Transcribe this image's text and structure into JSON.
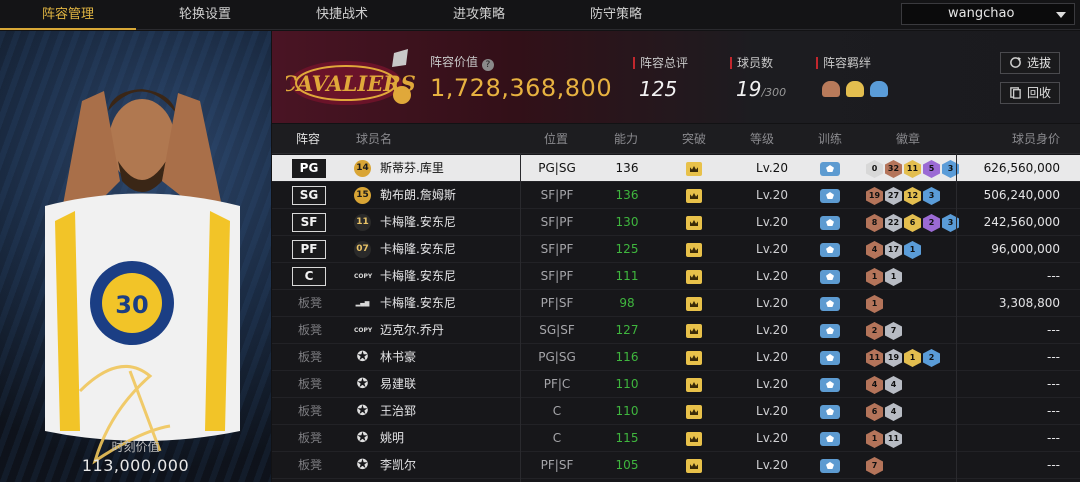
{
  "nav": {
    "tabs": [
      "阵容管理",
      "轮换设置",
      "快捷战术",
      "进攻策略",
      "防守策略"
    ],
    "active": 0,
    "user": "wangchao"
  },
  "card": {
    "label": "时刻价值",
    "value": "113,000,000"
  },
  "header": {
    "value_label": "阵容价值",
    "value": "1,728,368,800",
    "rating_label": "阵容总评",
    "rating": "125",
    "count_label": "球员数",
    "count": "19",
    "count_max": "/300",
    "bond_label": "阵容羁绊",
    "btn_select": "选拔",
    "btn_recycle": "回收"
  },
  "colors": {
    "accent_gold": "#e7b240",
    "ability_green": "#3fb63e",
    "team_red": "#c2272d"
  },
  "table": {
    "headers": [
      "阵容",
      "球员名",
      "位置",
      "能力",
      "突破",
      "等级",
      "训练",
      "徽章",
      "球员身价"
    ],
    "rows": [
      {
        "slot": "PG",
        "starter": true,
        "num": "14",
        "num_style": "gold",
        "name": "斯蒂芬.库里",
        "pos": "PG|SG",
        "ability": "136",
        "level": "Lv.20",
        "badges": [
          [
            "0",
            "white"
          ],
          [
            "32",
            "bronze"
          ],
          [
            "11",
            "gold"
          ],
          [
            "5",
            "purple"
          ],
          [
            "3",
            "blue"
          ]
        ],
        "salary": "626,560,000",
        "selected": true
      },
      {
        "slot": "SG",
        "starter": true,
        "num": "15",
        "num_style": "gold",
        "name": "勒布朗.詹姆斯",
        "pos": "SF|PF",
        "ability": "136",
        "level": "Lv.20",
        "badges": [
          [
            "19",
            "bronze"
          ],
          [
            "27",
            "silver"
          ],
          [
            "12",
            "gold"
          ],
          [
            "3",
            "blue"
          ]
        ],
        "salary": "506,240,000"
      },
      {
        "slot": "SF",
        "starter": true,
        "num": "11",
        "num_style": "dark",
        "name": "卡梅隆.安东尼",
        "pos": "SF|PF",
        "ability": "130",
        "level": "Lv.20",
        "badges": [
          [
            "8",
            "bronze"
          ],
          [
            "22",
            "silver"
          ],
          [
            "6",
            "gold"
          ],
          [
            "2",
            "purple"
          ],
          [
            "3",
            "blue"
          ]
        ],
        "salary": "242,560,000"
      },
      {
        "slot": "PF",
        "starter": true,
        "num": "07",
        "num_style": "dark",
        "name": "卡梅隆.安东尼",
        "pos": "SF|PF",
        "ability": "125",
        "level": "Lv.20",
        "badges": [
          [
            "4",
            "bronze"
          ],
          [
            "17",
            "silver"
          ],
          [
            "1",
            "blue"
          ]
        ],
        "salary": "96,000,000"
      },
      {
        "slot": "C",
        "starter": true,
        "num": "COPY",
        "num_style": "copy",
        "name": "卡梅隆.安东尼",
        "pos": "SF|PF",
        "ability": "111",
        "level": "Lv.20",
        "badges": [
          [
            "1",
            "bronze"
          ],
          [
            "1",
            "silver"
          ]
        ],
        "salary": "---"
      },
      {
        "slot": "板凳",
        "starter": false,
        "num": "▂▄▆",
        "num_style": "copy",
        "name": "卡梅隆.安东尼",
        "pos": "PF|SF",
        "ability": "98",
        "level": "Lv.20",
        "badges": [
          [
            "1",
            "bronze"
          ]
        ],
        "salary": "3,308,800"
      },
      {
        "slot": "板凳",
        "starter": false,
        "num": "COPY",
        "num_style": "copy",
        "name": "迈克尔.乔丹",
        "pos": "SG|SF",
        "ability": "127",
        "level": "Lv.20",
        "badges": [
          [
            "2",
            "bronze"
          ],
          [
            "7",
            "silver"
          ]
        ],
        "salary": "---"
      },
      {
        "slot": "板凳",
        "starter": false,
        "num": "✪",
        "num_style": "star",
        "name": "林书豪",
        "pos": "PG|SG",
        "ability": "116",
        "level": "Lv.20",
        "badges": [
          [
            "11",
            "bronze"
          ],
          [
            "19",
            "silver"
          ],
          [
            "1",
            "gold"
          ],
          [
            "2",
            "blue"
          ]
        ],
        "salary": "---"
      },
      {
        "slot": "板凳",
        "starter": false,
        "num": "✪",
        "num_style": "star",
        "name": "易建联",
        "pos": "PF|C",
        "ability": "110",
        "level": "Lv.20",
        "badges": [
          [
            "4",
            "bronze"
          ],
          [
            "4",
            "silver"
          ]
        ],
        "salary": "---"
      },
      {
        "slot": "板凳",
        "starter": false,
        "num": "✪",
        "num_style": "star",
        "name": "王治郅",
        "pos": "C",
        "ability": "110",
        "level": "Lv.20",
        "badges": [
          [
            "6",
            "bronze"
          ],
          [
            "4",
            "silver"
          ]
        ],
        "salary": "---"
      },
      {
        "slot": "板凳",
        "starter": false,
        "num": "✪",
        "num_style": "star",
        "name": "姚明",
        "pos": "C",
        "ability": "115",
        "level": "Lv.20",
        "badges": [
          [
            "1",
            "bronze"
          ],
          [
            "11",
            "silver"
          ]
        ],
        "salary": "---"
      },
      {
        "slot": "板凳",
        "starter": false,
        "num": "✪",
        "num_style": "star",
        "name": "李凯尔",
        "pos": "PF|SF",
        "ability": "105",
        "level": "Lv.20",
        "badges": [
          [
            "7",
            "bronze"
          ]
        ],
        "salary": "---"
      }
    ]
  }
}
